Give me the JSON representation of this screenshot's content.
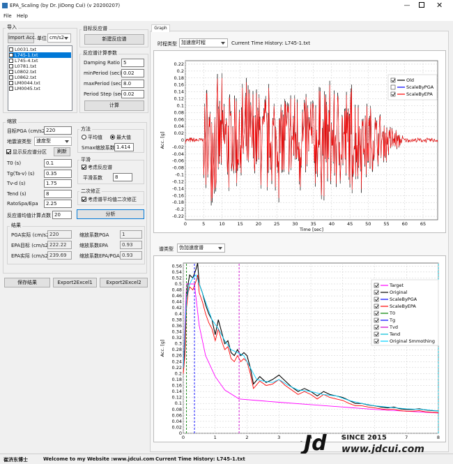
{
  "window": {
    "title": "EPA_Scaling (by Dr. JiDong Cui) (v 20200207)"
  },
  "menu": [
    "File",
    "Help"
  ],
  "import": {
    "title": "导入",
    "btn": "Import Acc.",
    "unit_label": "单位",
    "unit": "cm/s2",
    "files": [
      "L0031.txt",
      "L745-1.txt",
      "L745-4.txt",
      "L0781.txt",
      "L0802.txt",
      "L0862.txt",
      "LM0044.txt",
      "LM0045.txt"
    ],
    "selected": 1
  },
  "target": {
    "title": "目标反应谱",
    "btn": "新建反应谱"
  },
  "calc": {
    "title": "反应谱计算参数",
    "fields": [
      [
        "Damping Ratio",
        "5"
      ],
      [
        "minPeriod (sec)",
        "0.02"
      ],
      [
        "maxPeriod (sec)",
        "8.0"
      ],
      [
        "Period Step (sec)",
        "0.02"
      ]
    ],
    "btn": "计算"
  },
  "scale": {
    "title": "缩放",
    "pga_label": "目标PGA (cm/s2)",
    "pga": "220",
    "quake_label": "地震波类型",
    "quake_type": "速度型",
    "show_label": "显示反应谱分区",
    "refresh": "刷新",
    "params": [
      [
        "T0 (s)",
        "0.1"
      ],
      [
        "Tg(Ta-v) (s)",
        "0.35"
      ],
      [
        "Tv-d (s)",
        "1.75"
      ],
      [
        "Tend (s)",
        "8"
      ],
      [
        "RatoSpa/Epa",
        "2.25"
      ]
    ],
    "points_label": "反应谱均值计算点数",
    "points": "20",
    "method_title": "方法",
    "avg": "平均值",
    "max": "最大值",
    "smax_label": "Smax缩放系数",
    "smax": "1.414",
    "smooth_title": "平滑",
    "smooth_check": "考虑反应谱",
    "smooth_coef_label": "平滑系数",
    "smooth_coef": "8",
    "second_title": "二次修正",
    "second_check": "考虑谱平均值二次修正",
    "analyze": "分析"
  },
  "results": {
    "title": "结果",
    "rows": [
      [
        "PGA实际 (cm/s2)",
        "220",
        "缩放系数PGA",
        "1"
      ],
      [
        "EPA目标 (cm/s2)",
        "222.22",
        "缩放系数EPA",
        "0.93"
      ],
      [
        "EPA实际 (cm/s2)",
        "239.69",
        "缩放系数EPA/PGA",
        "0.93"
      ]
    ]
  },
  "actions": [
    "保存结果",
    "Export2Excel1",
    "Export2Excel2"
  ],
  "tab": "Graph",
  "history": {
    "type_label": "时程类型",
    "type": "加速度时程",
    "current": "Current Time History: L745-1.txt"
  },
  "spectrum": {
    "type_label": "谱类型",
    "type": "伪加速度谱"
  },
  "status": {
    "author": "崔济东博士",
    "welcome": "Welcome to my Website :",
    "site": "www.jdcui.com",
    "current": "Current Time History: L745-1.txt"
  },
  "watermark": {
    "since": "SINCE 2015",
    "url": "www.jdcui.com"
  },
  "chart_data": [
    {
      "type": "line",
      "xlabel": "Time [sec]",
      "ylabel": "Acc. [g]",
      "xticks": [
        0,
        5,
        10,
        15,
        20,
        25,
        30,
        35,
        40,
        45,
        50,
        55,
        60,
        65
      ],
      "yticks": [
        -0.22,
        -0.2,
        -0.18,
        -0.16,
        -0.14,
        -0.12,
        -0.1,
        -0.08,
        -0.06,
        -0.04,
        -0.02,
        0,
        0.02,
        0.04,
        0.06,
        0.08,
        0.1,
        0.12,
        0.14,
        0.16,
        0.18,
        0.2,
        0.22
      ],
      "xlim": [
        0,
        69
      ],
      "ylim": [
        -0.23,
        0.23
      ],
      "legend": "top-right",
      "series": [
        {
          "name": "Old",
          "color": "#000000",
          "checked": true
        },
        {
          "name": "ScaleByPGA",
          "color": "#0000ff",
          "checked": false
        },
        {
          "name": "ScaleByEPA",
          "color": "#ff0000",
          "checked": true
        }
      ]
    },
    {
      "type": "line",
      "xlabel": "Period [s]",
      "ylabel": "Acc. [g]",
      "xticks": [
        0,
        1,
        2,
        3,
        4,
        5,
        6,
        7,
        8
      ],
      "yticks": [
        0,
        0.02,
        0.04,
        0.06,
        0.08,
        0.1,
        0.12,
        0.14,
        0.16,
        0.18,
        0.2,
        0.22,
        0.24,
        0.26,
        0.28,
        0.3,
        0.32,
        0.34,
        0.36,
        0.38,
        0.4,
        0.42,
        0.44,
        0.46,
        0.48,
        0.5,
        0.52,
        0.54,
        0.56
      ],
      "xlim": [
        0,
        8
      ],
      "ylim": [
        0,
        0.57
      ],
      "legend": "right",
      "series": [
        {
          "name": "Target",
          "color": "#ff00ff",
          "x": [
            0,
            0.1,
            0.35,
            0.5,
            0.7,
            1.0,
            1.3,
            1.75,
            3,
            4,
            5,
            6,
            7,
            8
          ],
          "y": [
            0.22,
            0.5,
            0.5,
            0.36,
            0.26,
            0.19,
            0.145,
            0.115,
            0.104,
            0.096,
            0.088,
            0.08,
            0.074,
            0.068
          ]
        },
        {
          "name": "Original",
          "color": "#000000",
          "x": [
            0,
            0.05,
            0.1,
            0.15,
            0.2,
            0.3,
            0.4,
            0.45,
            0.5,
            0.6,
            0.7,
            0.8,
            0.9,
            1.0,
            1.1,
            1.2,
            1.3,
            1.4,
            1.5,
            1.6,
            1.7,
            1.8,
            1.9,
            2.0,
            2.1,
            2.2,
            2.4,
            2.6,
            2.8,
            3.0,
            3.2,
            3.4,
            3.6,
            3.8,
            4.0,
            4.2,
            4.4,
            4.6,
            4.8,
            5.0,
            5.2,
            5.4,
            5.6,
            5.8,
            6.0,
            6.2,
            6.4,
            6.6,
            6.8,
            7.0,
            7.2,
            7.4,
            7.6,
            7.8,
            8.0
          ],
          "y": [
            0.22,
            0.28,
            0.45,
            0.5,
            0.53,
            0.52,
            0.55,
            0.57,
            0.5,
            0.47,
            0.43,
            0.4,
            0.38,
            0.33,
            0.38,
            0.34,
            0.3,
            0.31,
            0.27,
            0.26,
            0.28,
            0.26,
            0.27,
            0.26,
            0.22,
            0.165,
            0.19,
            0.17,
            0.18,
            0.195,
            0.175,
            0.155,
            0.14,
            0.15,
            0.14,
            0.125,
            0.14,
            0.13,
            0.125,
            0.12,
            0.11,
            0.1,
            0.1,
            0.095,
            0.092,
            0.088,
            0.085,
            0.088,
            0.082,
            0.08,
            0.08,
            0.082,
            0.078,
            0.076,
            0.075
          ]
        },
        {
          "name": "ScaleByPGA",
          "color": "#0000ff",
          "checked": true
        },
        {
          "name": "ScaleByEPA",
          "color": "#ff0000",
          "x": [
            0,
            0.05,
            0.1,
            0.15,
            0.2,
            0.3,
            0.4,
            0.45,
            0.5,
            0.6,
            0.7,
            0.8,
            0.9,
            1.0,
            1.1,
            1.2,
            1.3,
            1.4,
            1.5,
            1.6,
            1.7,
            1.8,
            1.9,
            2.0,
            2.1,
            2.2,
            2.4,
            2.6,
            2.8,
            3.0,
            3.2,
            3.4,
            3.6,
            3.8,
            4.0,
            4.2,
            4.4,
            4.6,
            4.8,
            5.0,
            5.2,
            5.4,
            5.6,
            5.8,
            6.0,
            6.2,
            6.4,
            6.6,
            6.8,
            7.0,
            7.2,
            7.4,
            7.6,
            7.8,
            8.0
          ],
          "y": [
            0.2,
            0.26,
            0.42,
            0.47,
            0.49,
            0.48,
            0.51,
            0.53,
            0.47,
            0.44,
            0.4,
            0.37,
            0.35,
            0.31,
            0.35,
            0.31,
            0.28,
            0.29,
            0.25,
            0.24,
            0.26,
            0.24,
            0.25,
            0.24,
            0.2,
            0.15,
            0.175,
            0.16,
            0.165,
            0.18,
            0.16,
            0.145,
            0.13,
            0.14,
            0.13,
            0.115,
            0.13,
            0.12,
            0.115,
            0.11,
            0.1,
            0.092,
            0.092,
            0.088,
            0.085,
            0.082,
            0.079,
            0.081,
            0.076,
            0.074,
            0.074,
            0.076,
            0.072,
            0.07,
            0.069
          ]
        },
        {
          "name": "T0",
          "color": "#008000",
          "x": [
            0.1,
            0.1
          ],
          "y": [
            0,
            0.57
          ]
        },
        {
          "name": "Tg",
          "color": "#0000ff",
          "x": [
            0.35,
            0.35
          ],
          "y": [
            0,
            0.57
          ]
        },
        {
          "name": "Tvd",
          "color": "#cc00cc",
          "x": [
            1.75,
            1.75
          ],
          "y": [
            0,
            0.57
          ]
        },
        {
          "name": "Tend",
          "color": "#00bcd4",
          "x": [
            8,
            8
          ],
          "y": [
            0,
            0.57
          ]
        },
        {
          "name": "Original Smmothing",
          "color": "#00d0ff",
          "x": [
            0,
            0.1,
            0.2,
            0.3,
            0.4,
            0.5,
            0.7,
            0.9,
            1.1,
            1.3,
            1.5,
            1.7,
            1.9,
            2.1,
            2.3,
            2.5,
            2.8,
            3.0,
            3.3,
            3.6,
            4.0,
            4.4,
            4.8,
            5.2,
            5.6,
            6.0,
            6.5,
            7.0,
            7.5,
            8.0
          ],
          "y": [
            0.22,
            0.45,
            0.5,
            0.52,
            0.53,
            0.5,
            0.44,
            0.38,
            0.35,
            0.31,
            0.28,
            0.27,
            0.26,
            0.22,
            0.18,
            0.175,
            0.17,
            0.18,
            0.16,
            0.145,
            0.14,
            0.13,
            0.125,
            0.11,
            0.1,
            0.092,
            0.087,
            0.082,
            0.08,
            0.075
          ]
        }
      ]
    }
  ]
}
